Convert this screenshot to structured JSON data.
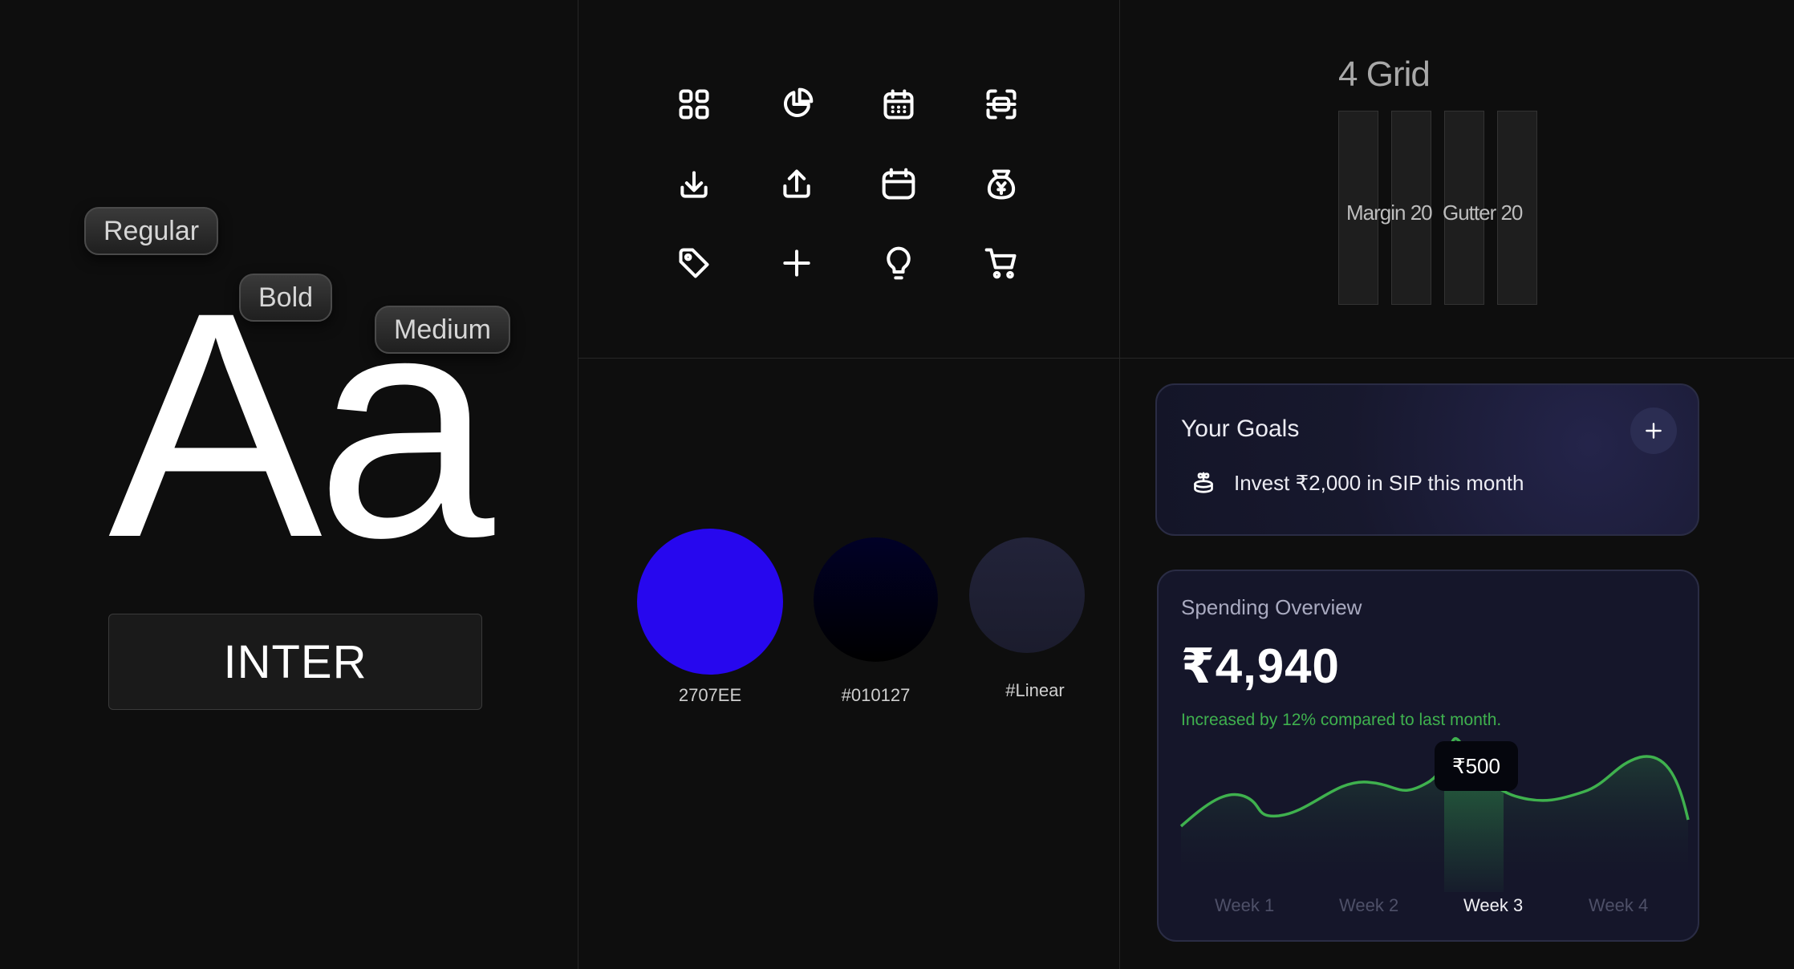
{
  "typography": {
    "weights": [
      "Regular",
      "Bold",
      "Medium"
    ],
    "sample": "Aa",
    "font_name": "INTER"
  },
  "icons": [
    "grid-icon",
    "pie-chart-icon",
    "calendar-grid-icon",
    "scan-icon",
    "download-icon",
    "upload-icon",
    "calendar-icon",
    "money-bag-icon",
    "tag-icon",
    "plus-icon",
    "lightbulb-icon",
    "cart-icon"
  ],
  "grid": {
    "title": "4 Grid",
    "margin_label": "Margin 20",
    "gutter_label": "Gutter 20"
  },
  "colors": [
    {
      "label": "2707EE",
      "hex": "#2707EE"
    },
    {
      "label": "#010127",
      "hex": "#010127"
    },
    {
      "label": "#Linear",
      "hex": "#1e1f33"
    }
  ],
  "goals": {
    "title": "Your Goals",
    "item": "Invest ₹2,000 in SIP this month"
  },
  "spending": {
    "title": "Spending Overview",
    "amount": "₹4,940",
    "note": "Increased by 12% compared to last month.",
    "tooltip": "₹500",
    "weeks": [
      "Week 1",
      "Week 2",
      "Week 3",
      "Week 4"
    ],
    "active_week": "Week 3",
    "line_color": "#3fb14e"
  }
}
